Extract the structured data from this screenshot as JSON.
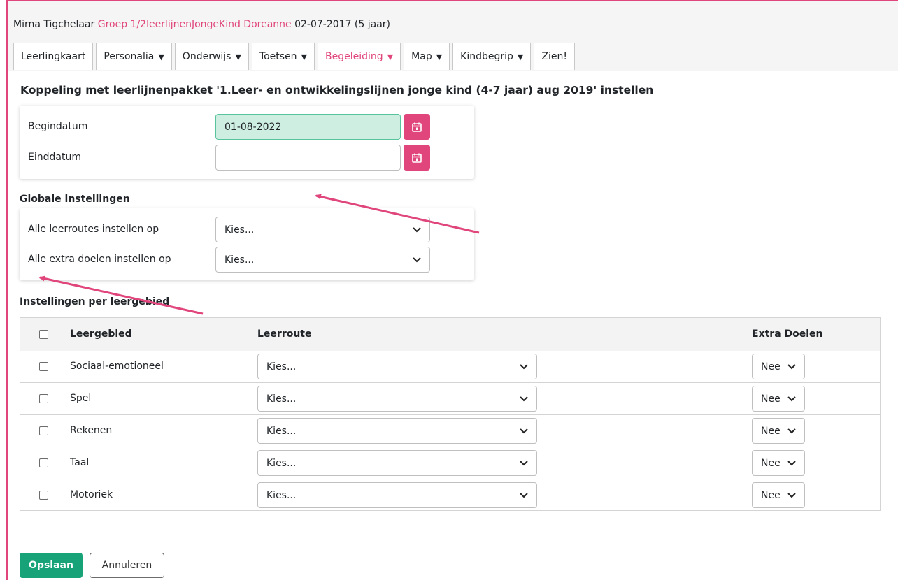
{
  "header": {
    "student_name": "Mirna Tigchelaar",
    "student_group": "Groep 1/2leerlijnenJongeKind Doreanne",
    "student_birth": "02-07-2017 (5 jaar)"
  },
  "tabs": [
    {
      "label": "Leerlingkaart",
      "has_menu": false
    },
    {
      "label": "Personalia",
      "has_menu": true
    },
    {
      "label": "Onderwijs",
      "has_menu": true
    },
    {
      "label": "Toetsen",
      "has_menu": true
    },
    {
      "label": "Begeleiding",
      "has_menu": true,
      "active": true
    },
    {
      "label": "Map",
      "has_menu": true
    },
    {
      "label": "Kindbegrip",
      "has_menu": true
    },
    {
      "label": "Zien!",
      "has_menu": false
    }
  ],
  "page_title": "Koppeling met leerlijnenpakket '1.Leer- en ontwikkelingslijnen jonge kind (4-7 jaar) aug 2019' instellen",
  "dates": {
    "begin_label": "Begindatum",
    "begin_value": "01-08-2022",
    "end_label": "Einddatum",
    "end_value": ""
  },
  "global": {
    "heading": "Globale instellingen",
    "routes_label": "Alle leerroutes instellen op",
    "routes_value": "Kies...",
    "extra_label": "Alle extra doelen instellen op",
    "extra_value": "Kies..."
  },
  "per_area": {
    "heading": "Instellingen per leergebied",
    "columns": {
      "area": "Leergebied",
      "route": "Leerroute",
      "extra": "Extra Doelen"
    },
    "rows": [
      {
        "area": "Sociaal-emotioneel",
        "route": "Kies...",
        "extra": "Nee"
      },
      {
        "area": "Spel",
        "route": "Kies...",
        "extra": "Nee"
      },
      {
        "area": "Rekenen",
        "route": "Kies...",
        "extra": "Nee"
      },
      {
        "area": "Taal",
        "route": "Kies...",
        "extra": "Nee"
      },
      {
        "area": "Motoriek",
        "route": "Kies...",
        "extra": "Nee"
      }
    ]
  },
  "footer": {
    "save_label": "Opslaan",
    "cancel_label": "Annuleren"
  },
  "colors": {
    "accent": "#e0457b",
    "save": "#17a277",
    "filled_date": "#cfeee2"
  }
}
